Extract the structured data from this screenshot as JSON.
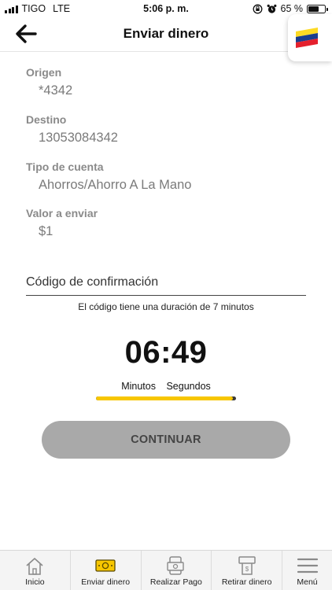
{
  "status_bar": {
    "carrier": "TIGO",
    "network": "LTE",
    "time": "5:06 p. m.",
    "battery_text": "65 %",
    "battery_level": 0.65
  },
  "header": {
    "title": "Enviar dinero"
  },
  "form": {
    "origin": {
      "label": "Origen",
      "value": "*4342"
    },
    "destination": {
      "label": "Destino",
      "value": "13053084342"
    },
    "account_type": {
      "label": "Tipo de cuenta",
      "value": "Ahorros/Ahorro A La Mano"
    },
    "amount": {
      "label": "Valor a enviar",
      "value": "$1"
    },
    "confirmation_code": {
      "placeholder": "Código de confirmación",
      "value": ""
    }
  },
  "code_note": "El código tiene una duración de 7 minutos",
  "timer": {
    "display": "06:49",
    "minutes_label": "Minutos",
    "seconds_label": "Segundos",
    "progress": 0.98
  },
  "continue_label": "CONTINUAR",
  "tabbar": {
    "items": [
      {
        "label": "Inicio",
        "icon": "home-icon"
      },
      {
        "label": "Enviar dinero",
        "icon": "money-bill-icon"
      },
      {
        "label": "Realizar Pago",
        "icon": "payment-icon"
      },
      {
        "label": "Retirar dinero",
        "icon": "atm-withdraw-icon"
      },
      {
        "label": "Menú",
        "icon": "hamburger-menu-icon"
      }
    ]
  },
  "colors": {
    "accent_yellow": "#f7c600",
    "button_disabled": "#a9a9a9",
    "brand_yellow": "#fdda24",
    "brand_blue": "#1a3d8f",
    "brand_red": "#e4202d"
  }
}
